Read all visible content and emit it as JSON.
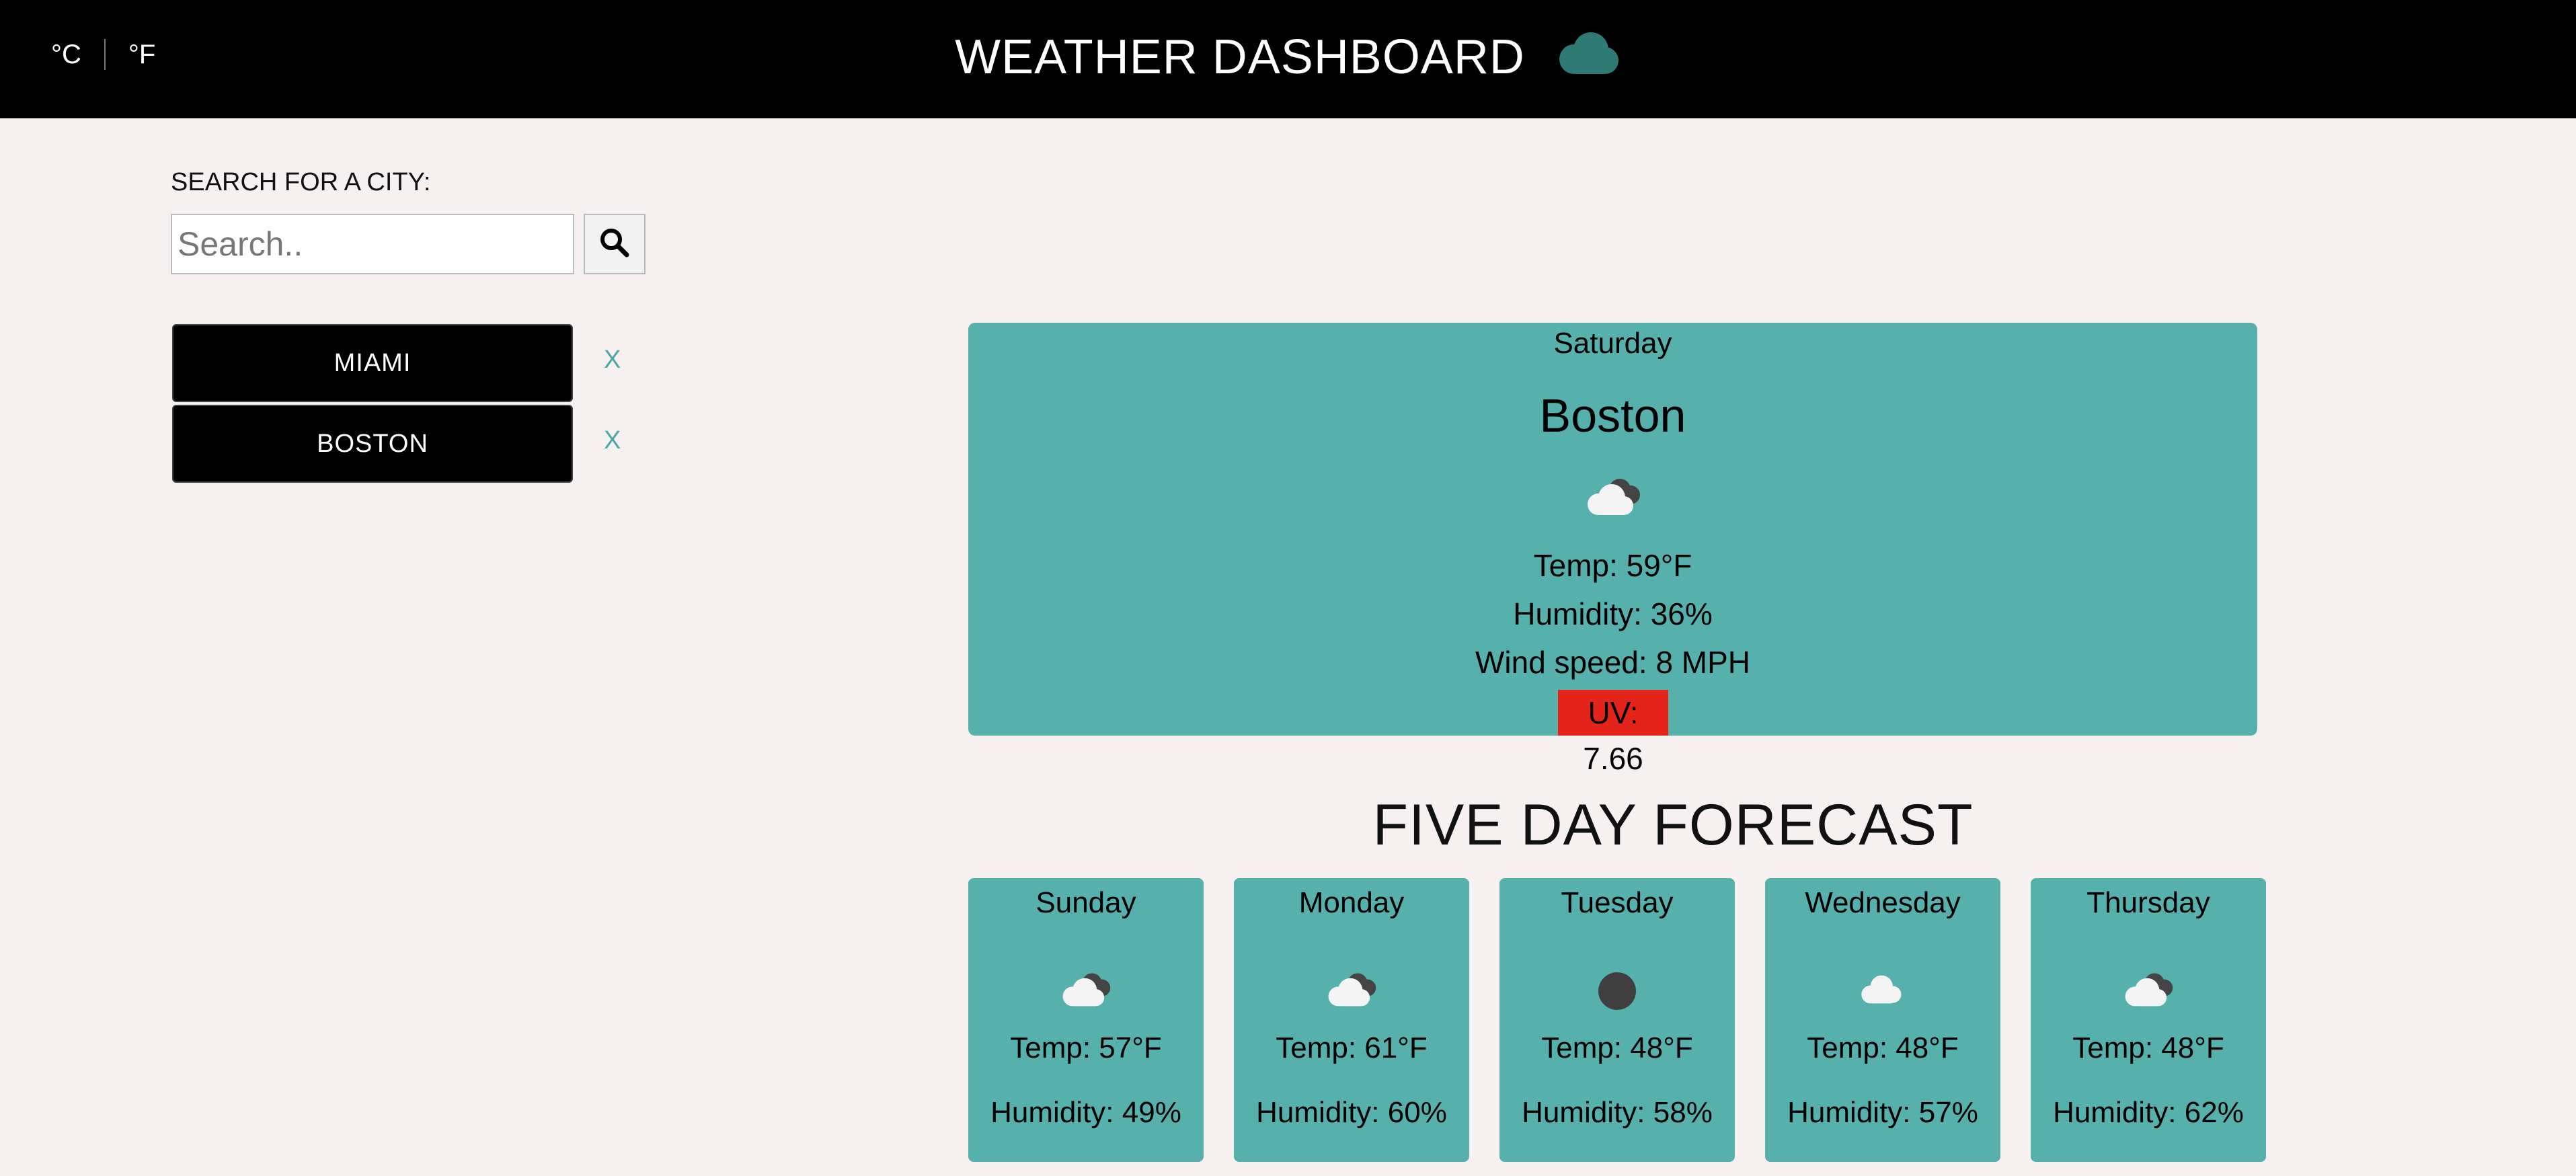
{
  "header": {
    "unit_c": "°C",
    "unit_f": "°F",
    "title": "WEATHER DASHBOARD",
    "title_icon": "cloud-icon",
    "brand_color": "#2f7a74"
  },
  "sidebar": {
    "search_label": "SEARCH FOR A CITY:",
    "search_placeholder": "Search..",
    "search_icon": "search-icon",
    "cities": [
      {
        "name": "MIAMI",
        "remove": "X"
      },
      {
        "name": "BOSTON",
        "remove": "X"
      }
    ]
  },
  "current": {
    "day": "Saturday",
    "city": "Boston",
    "icon": "partly-cloudy-icon",
    "temp": "Temp: 59°F",
    "humidity": "Humidity: 36%",
    "wind": "Wind speed: 8 MPH",
    "uv": "UV: 7.66",
    "uv_color": "#e4241a",
    "card_color": "#56b1ad"
  },
  "forecast": {
    "title": "FIVE DAY FORECAST",
    "days": [
      {
        "day": "Sunday",
        "icon": "partly-cloudy-icon",
        "temp": "Temp: 57°F",
        "humidity": "Humidity: 49%"
      },
      {
        "day": "Monday",
        "icon": "partly-cloudy-icon",
        "temp": "Temp: 61°F",
        "humidity": "Humidity: 60%"
      },
      {
        "day": "Tuesday",
        "icon": "moon-icon",
        "temp": "Temp: 48°F",
        "humidity": "Humidity: 58%"
      },
      {
        "day": "Wednesday",
        "icon": "cloud-icon",
        "temp": "Temp: 48°F",
        "humidity": "Humidity: 57%"
      },
      {
        "day": "Thursday",
        "icon": "partly-cloudy-icon",
        "temp": "Temp: 48°F",
        "humidity": "Humidity: 62%"
      }
    ]
  }
}
